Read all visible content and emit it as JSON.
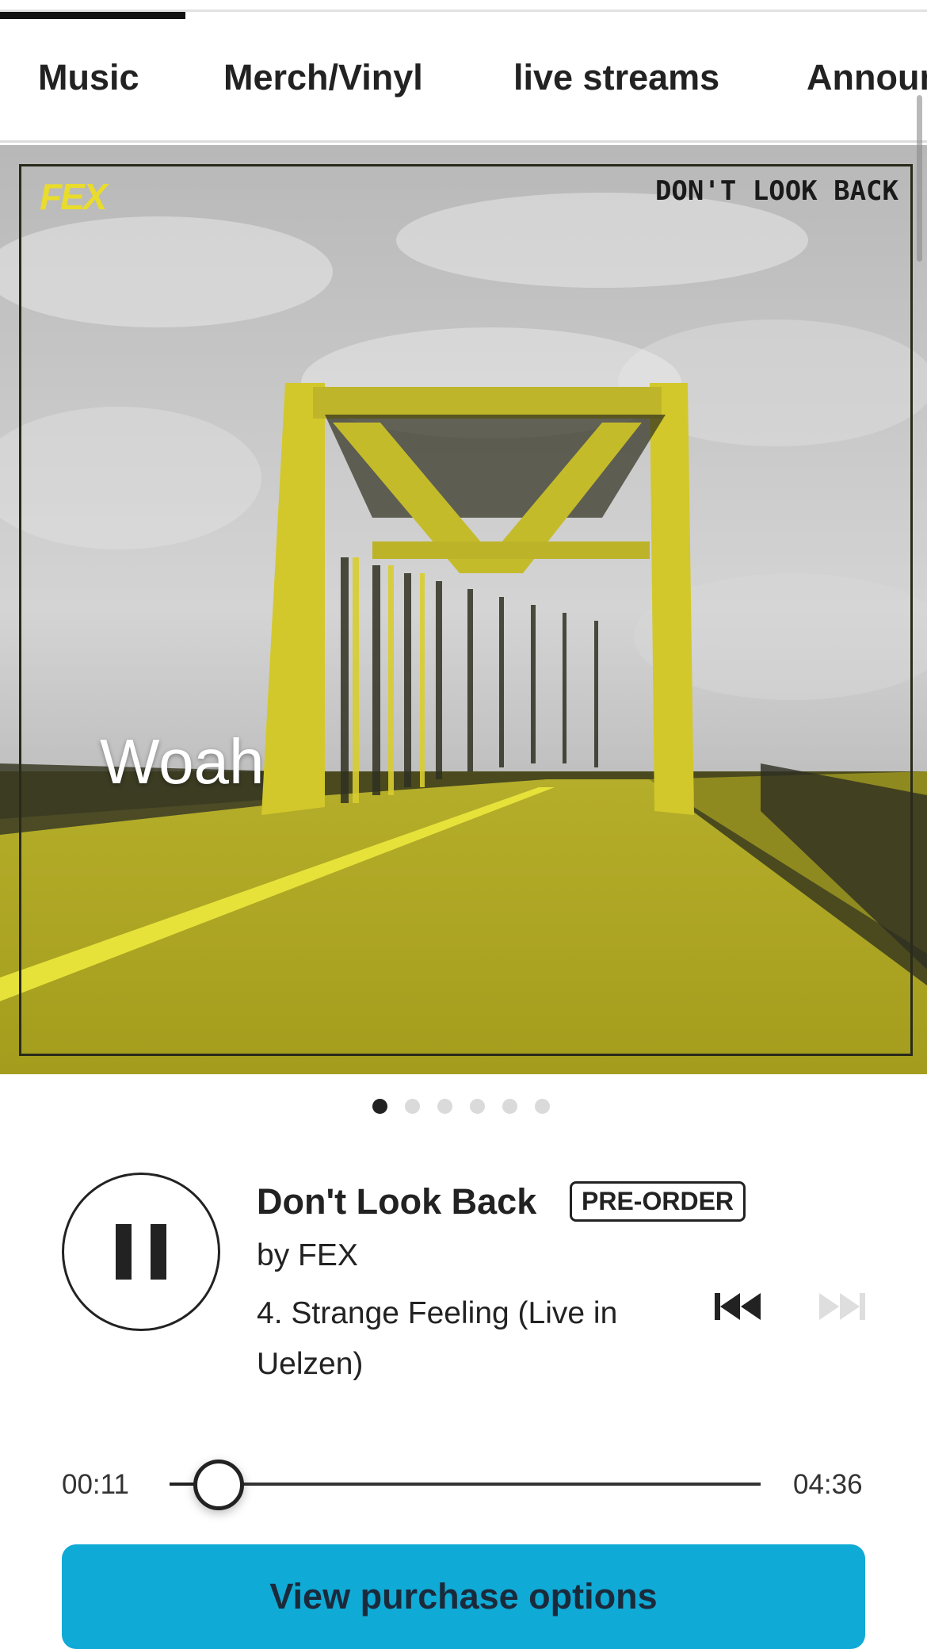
{
  "tabs": [
    {
      "label": "Music"
    },
    {
      "label": "Merch/Vinyl"
    },
    {
      "label": "live streams"
    },
    {
      "label": "Announ"
    }
  ],
  "hero": {
    "caption": "Woah",
    "cover_logo": "FEX",
    "cover_title": "DON'T LOOK BACK",
    "slides_total": 6,
    "active_slide": 1
  },
  "player": {
    "state": "playing",
    "title": "Don't Look Back",
    "badge": "PRE-ORDER",
    "artist": "by FEX",
    "track": "4. Strange Feeling (Live in Uelzen)",
    "elapsed": "00:11",
    "duration": "04:36",
    "progress_fraction": 0.04
  },
  "actions": {
    "buy_label": "View purchase options"
  },
  "colors": {
    "accent": "#10aad6",
    "cover_yellow": "#c9c224",
    "text": "#222222"
  },
  "icons": {
    "play": "pause-icon",
    "prev": "skip-previous-icon",
    "next": "skip-next-icon"
  }
}
